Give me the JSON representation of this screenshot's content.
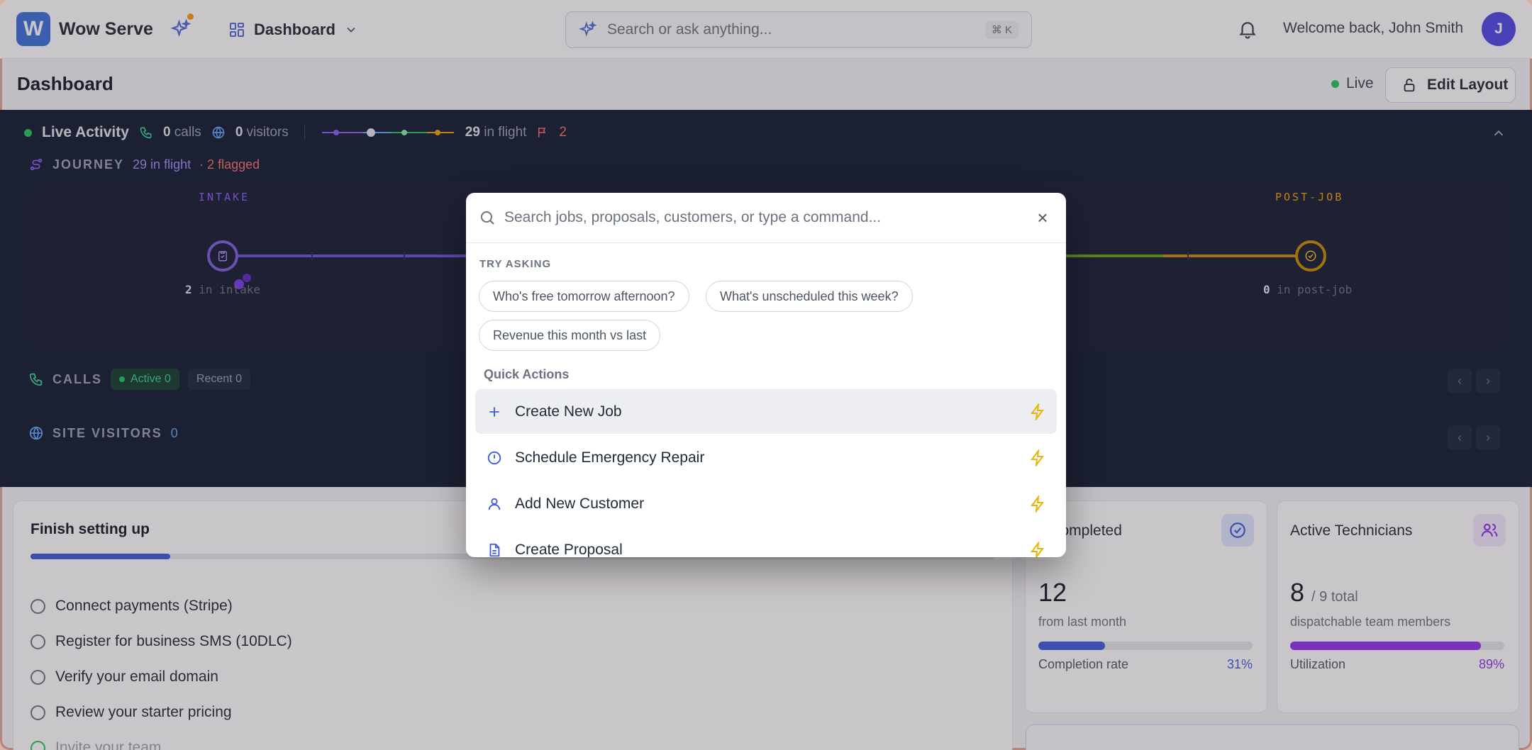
{
  "topbar": {
    "logo_letter": "W",
    "brand": "Wow Serve",
    "dashboard_label": "Dashboard",
    "search_placeholder": "Search or ask anything...",
    "search_shortcut": "⌘ K",
    "welcome": "Welcome back, John Smith",
    "avatar_initial": "J"
  },
  "page": {
    "title": "Dashboard",
    "live_label": "Live",
    "edit_layout_label": "Edit Layout"
  },
  "live_activity": {
    "title": "Live Activity",
    "calls_count": "0",
    "calls_label": "calls",
    "visitors_count": "0",
    "visitors_label": "visitors",
    "in_flight_count": "29",
    "in_flight_label": "in flight",
    "flag_count": "2",
    "journey": {
      "label": "JOURNEY",
      "in_flight": "29 in flight",
      "flagged": "· 2 flagged",
      "stages": [
        {
          "label": "INTAKE",
          "count": "2",
          "count_suffix": "in intake",
          "color": "#8b5cf6"
        },
        {
          "label": "POST-JOB",
          "count": "0",
          "count_suffix": "in post-job",
          "color": "#f59e0b"
        }
      ]
    },
    "calls": {
      "label": "CALLS",
      "active": "Active 0",
      "recent": "Recent 0"
    },
    "site_visitors": {
      "label": "SITE VISITORS",
      "count": "0"
    }
  },
  "setup": {
    "title": "Finish setting up",
    "progress": 0.145,
    "tasks": [
      {
        "label": "Connect payments (Stripe)",
        "done": false
      },
      {
        "label": "Register for business SMS (10DLC)",
        "done": false
      },
      {
        "label": "Verify your email domain",
        "done": false
      },
      {
        "label": "Review your starter pricing",
        "done": false
      },
      {
        "label": "Invite your team",
        "done": true
      }
    ]
  },
  "stats": [
    {
      "title": "Jobs Completed",
      "visible_title": "s Completed",
      "value": "12",
      "value_suffix": "",
      "sub": "from last month",
      "foot_label": "Completion rate",
      "foot_value": "31%",
      "fraction": 0.31,
      "color": "#3b5bdb",
      "icon": "check-circle-icon"
    },
    {
      "title": "Active Technicians",
      "visible_title": "Active Technicians",
      "value": "8",
      "value_suffix": "/ 9 total",
      "sub": "dispatchable team members",
      "foot_label": "Utilization",
      "foot_value": "89%",
      "fraction": 0.89,
      "color": "#9333ea",
      "icon": "users-icon"
    }
  ],
  "palette": {
    "search_placeholder": "Search jobs, proposals, customers, or type a command...",
    "try_label": "TRY ASKING",
    "suggestions": [
      "Who's free tomorrow afternoon?",
      "What's unscheduled this week?",
      "Revenue this month vs last"
    ],
    "quick_actions_label": "Quick Actions",
    "quick_actions": [
      {
        "label": "Create New Job",
        "icon": "plus-icon",
        "selected": true
      },
      {
        "label": "Schedule Emergency Repair",
        "icon": "alert-circle-icon",
        "selected": false
      },
      {
        "label": "Add New Customer",
        "icon": "user-icon",
        "selected": false
      },
      {
        "label": "Create Proposal",
        "icon": "document-icon",
        "selected": false
      }
    ]
  },
  "colors": {
    "accent": "#3b5bdb",
    "live_green": "#22c55e",
    "bolt": "#eab308",
    "panel_dark": "#0f1a2e"
  }
}
